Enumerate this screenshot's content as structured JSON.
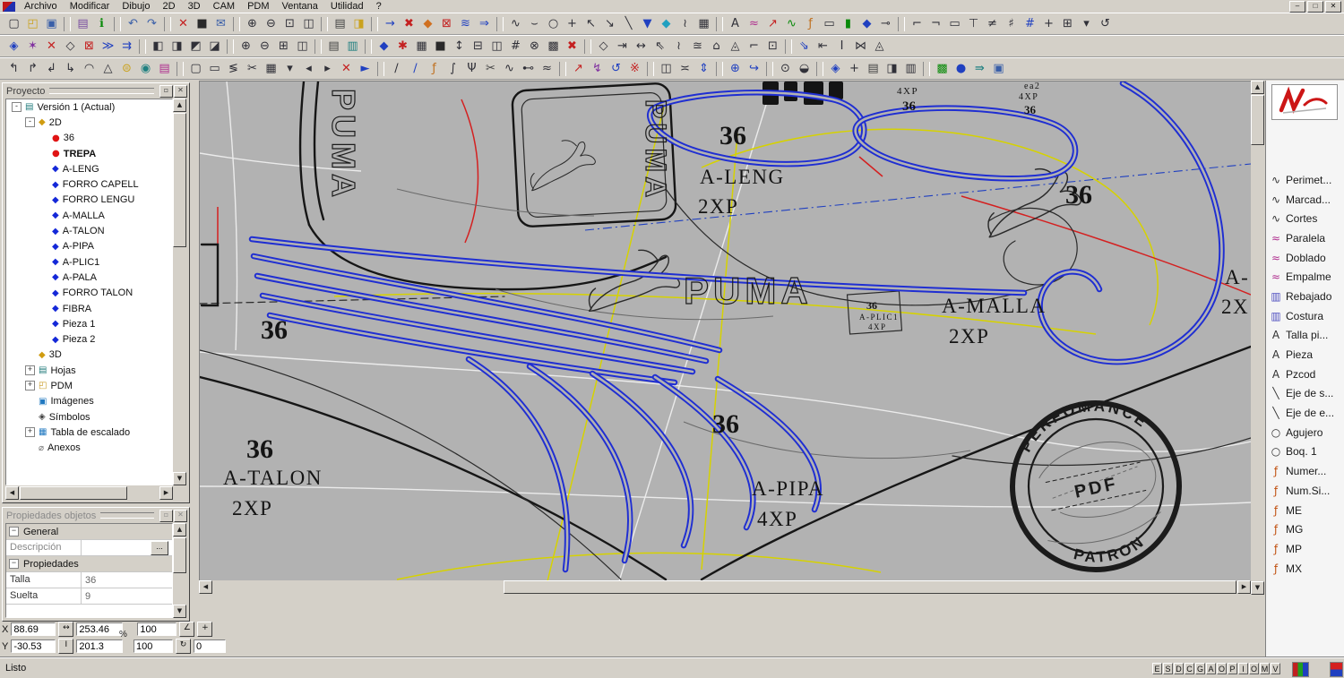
{
  "window": {
    "controls": [
      "–",
      "□",
      "✕"
    ]
  },
  "menu": {
    "items": [
      "Archivo",
      "Modificar",
      "Dibujo",
      "2D",
      "3D",
      "CAM",
      "PDM",
      "Ventana",
      "Utilidad",
      "?"
    ]
  },
  "toolbars": {
    "row1": [
      {
        "g": "▢"
      },
      {
        "g": "◰",
        "c": "#caa21e"
      },
      {
        "g": "▣",
        "c": "#3a5fa8"
      },
      {
        "cls": "sep"
      },
      {
        "g": "▤",
        "c": "#7a4fa0"
      },
      {
        "g": "ℹ",
        "c": "#0a8a0a"
      },
      {
        "cls": "sep"
      },
      {
        "g": "↶",
        "c": "#3a5fa8"
      },
      {
        "g": "↷",
        "c": "#3a5fa8"
      },
      {
        "cls": "sep"
      },
      {
        "g": "✕",
        "c": "#c42020"
      },
      {
        "g": "■",
        "c": "#2a2a2a"
      },
      {
        "g": "✉",
        "c": "#3a5fa8"
      },
      {
        "cls": "sep"
      },
      {
        "g": "⊕"
      },
      {
        "g": "⊖"
      },
      {
        "g": "⊡"
      },
      {
        "g": "◫"
      },
      {
        "cls": "sep"
      },
      {
        "g": "▤",
        "c": "#444444"
      },
      {
        "g": "◨",
        "c": "#caa21e"
      },
      {
        "cls": "sep"
      },
      {
        "g": "→",
        "c": "#2040c0"
      },
      {
        "g": "✖",
        "c": "#c42020"
      },
      {
        "g": "◆",
        "c": "#d07020"
      },
      {
        "g": "⊠",
        "c": "#c42020"
      },
      {
        "g": "≋",
        "c": "#2040c0"
      },
      {
        "g": "⇒",
        "c": "#2040c0"
      },
      {
        "cls": "sep"
      },
      {
        "g": "∿"
      },
      {
        "g": "⌣"
      },
      {
        "g": "○"
      },
      {
        "g": "+"
      },
      {
        "g": "↖"
      },
      {
        "g": "↘"
      },
      {
        "g": "╲"
      },
      {
        "g": "▼",
        "c": "#2040c0"
      },
      {
        "g": "◆",
        "c": "#20a0c0"
      },
      {
        "g": "≀"
      },
      {
        "g": "▦"
      },
      {
        "cls": "sep"
      },
      {
        "g": "A"
      },
      {
        "g": "≈",
        "c": "#b03090"
      },
      {
        "g": "↗",
        "c": "#c42020"
      },
      {
        "g": "∿",
        "c": "#0a8a0a"
      },
      {
        "g": "ƒ",
        "c": "#c07020"
      },
      {
        "g": "▭"
      },
      {
        "g": "▮",
        "c": "#0a8a0a"
      },
      {
        "g": "◆",
        "c": "#2040c0"
      },
      {
        "g": "⊸"
      },
      {
        "cls": "sep"
      },
      {
        "g": "⌐"
      },
      {
        "g": "¬"
      },
      {
        "g": "▭"
      },
      {
        "g": "⊤"
      },
      {
        "g": "≠"
      },
      {
        "g": "♯"
      },
      {
        "g": "#",
        "c": "#2040c0"
      },
      {
        "g": "+"
      },
      {
        "g": "⊞"
      },
      {
        "g": "▾"
      },
      {
        "g": "↺"
      }
    ],
    "row2": [
      {
        "g": "◈",
        "c": "#2040c0"
      },
      {
        "g": "✶",
        "c": "#8030a0"
      },
      {
        "g": "✕",
        "c": "#c42020"
      },
      {
        "g": "◇"
      },
      {
        "g": "⊠",
        "c": "#c42020"
      },
      {
        "g": "≫",
        "c": "#2040c0"
      },
      {
        "g": "⇉",
        "c": "#2040c0"
      },
      {
        "cls": "sep"
      },
      {
        "g": "◧"
      },
      {
        "g": "◨"
      },
      {
        "g": "◩"
      },
      {
        "g": "◪"
      },
      {
        "cls": "sep"
      },
      {
        "g": "⊕"
      },
      {
        "g": "⊖"
      },
      {
        "g": "⊞"
      },
      {
        "g": "◫"
      },
      {
        "cls": "sep"
      },
      {
        "g": "▤",
        "c": "#444444"
      },
      {
        "g": "▥",
        "c": "#208080"
      },
      {
        "cls": "sep"
      },
      {
        "g": "◆",
        "c": "#2040c0"
      },
      {
        "g": "✱",
        "c": "#c42020"
      },
      {
        "g": "▦"
      },
      {
        "g": "■",
        "c": "#2a2a2a"
      },
      {
        "g": "↕"
      },
      {
        "g": "⊟"
      },
      {
        "g": "◫"
      },
      {
        "g": "#"
      },
      {
        "g": "⊗"
      },
      {
        "g": "▩"
      },
      {
        "g": "✖",
        "c": "#c42020"
      },
      {
        "cls": "sep"
      },
      {
        "g": "◇"
      },
      {
        "g": "⇥"
      },
      {
        "g": "↔"
      },
      {
        "g": "⇖"
      },
      {
        "g": "≀"
      },
      {
        "g": "≊"
      },
      {
        "g": "⌂"
      },
      {
        "g": "◬"
      },
      {
        "g": "⌐"
      },
      {
        "g": "⊡"
      },
      {
        "cls": "sep"
      },
      {
        "g": "⇘",
        "c": "#2040c0"
      },
      {
        "g": "⇤"
      },
      {
        "g": "Ⅰ"
      },
      {
        "g": "⋈"
      },
      {
        "g": "◬"
      }
    ],
    "row3": [
      {
        "g": "↰"
      },
      {
        "g": "↱"
      },
      {
        "g": "↲"
      },
      {
        "g": "↳"
      },
      {
        "g": "◠"
      },
      {
        "g": "△"
      },
      {
        "g": "⊜",
        "c": "#caa21e"
      },
      {
        "g": "◉",
        "c": "#208080"
      },
      {
        "g": "▤",
        "c": "#b03090"
      },
      {
        "cls": "sep"
      },
      {
        "g": "▢"
      },
      {
        "g": "▭"
      },
      {
        "g": "≶"
      },
      {
        "g": "✂"
      },
      {
        "g": "▦"
      },
      {
        "g": "▾"
      },
      {
        "g": "◂"
      },
      {
        "g": "▸"
      },
      {
        "g": "✕",
        "c": "#c42020"
      },
      {
        "g": "►",
        "c": "#2040c0"
      },
      {
        "cls": "sep"
      },
      {
        "g": "∕"
      },
      {
        "g": "∕",
        "c": "#2040c0"
      },
      {
        "g": "ƒ",
        "c": "#c07020"
      },
      {
        "g": "∫"
      },
      {
        "g": "Ψ"
      },
      {
        "g": "✂",
        "c": "#444444"
      },
      {
        "g": "∿"
      },
      {
        "g": "⊷"
      },
      {
        "g": "≈"
      },
      {
        "cls": "sep"
      },
      {
        "g": "↗",
        "c": "#c42020"
      },
      {
        "g": "↯",
        "c": "#8030a0"
      },
      {
        "g": "↺",
        "c": "#2040c0"
      },
      {
        "g": "※",
        "c": "#c42020"
      },
      {
        "cls": "sep"
      },
      {
        "g": "◫"
      },
      {
        "g": "≍"
      },
      {
        "g": "⇕",
        "c": "#2040c0"
      },
      {
        "cls": "sep"
      },
      {
        "g": "⊕",
        "c": "#2040c0"
      },
      {
        "g": "↪",
        "c": "#2040c0"
      },
      {
        "cls": "sep"
      },
      {
        "g": "⊙"
      },
      {
        "g": "◒"
      },
      {
        "cls": "sep"
      },
      {
        "g": "◈",
        "c": "#2040c0"
      },
      {
        "g": "+"
      },
      {
        "g": "▤",
        "c": "#444444"
      },
      {
        "g": "◨"
      },
      {
        "g": "▥"
      },
      {
        "cls": "sep"
      },
      {
        "g": "▩",
        "c": "#0a8a0a"
      },
      {
        "g": "●",
        "c": "#2040c0"
      },
      {
        "g": "⇛",
        "c": "#208080"
      },
      {
        "g": "▣",
        "c": "#3a5fa8"
      }
    ]
  },
  "project_panel": {
    "title": "Proyecto",
    "min_btn": "▫",
    "close_btn": "✕",
    "tree": [
      {
        "label": "Versión 1 (Actual)",
        "lvl": 0,
        "icon": "▤",
        "ic": "#1f7a7a",
        "box": "-"
      },
      {
        "label": "2D",
        "lvl": 1,
        "icon": "◆",
        "ic": "#d09c10",
        "box": "-"
      },
      {
        "label": "36",
        "lvl": 2,
        "icon": "●",
        "ic": "#e01414"
      },
      {
        "label": "TREPA",
        "lvl": 2,
        "icon": "●",
        "ic": "#e01414",
        "cls": "bold"
      },
      {
        "label": "A-LENG",
        "lvl": 2,
        "icon": "◆",
        "ic": "#1428d8"
      },
      {
        "label": "FORRO CAPELL",
        "lvl": 2,
        "icon": "◆",
        "ic": "#1428d8"
      },
      {
        "label": "FORRO LENGU",
        "lvl": 2,
        "icon": "◆",
        "ic": "#1428d8"
      },
      {
        "label": "A-MALLA",
        "lvl": 2,
        "icon": "◆",
        "ic": "#1428d8"
      },
      {
        "label": "A-TALON",
        "lvl": 2,
        "icon": "◆",
        "ic": "#1428d8"
      },
      {
        "label": "A-PIPA",
        "lvl": 2,
        "icon": "◆",
        "ic": "#1428d8"
      },
      {
        "label": "A-PLIC1",
        "lvl": 2,
        "icon": "◆",
        "ic": "#1428d8"
      },
      {
        "label": "A-PALA",
        "lvl": 2,
        "icon": "◆",
        "ic": "#1428d8"
      },
      {
        "label": "FORRO TALON",
        "lvl": 2,
        "icon": "◆",
        "ic": "#1428d8"
      },
      {
        "label": "FIBRA",
        "lvl": 2,
        "icon": "◆",
        "ic": "#1428d8"
      },
      {
        "label": "Pieza 1",
        "lvl": 2,
        "icon": "◆",
        "ic": "#1428d8"
      },
      {
        "label": "Pieza 2",
        "lvl": 2,
        "icon": "◆",
        "ic": "#1428d8"
      },
      {
        "label": "3D",
        "lvl": 1,
        "icon": "◆",
        "ic": "#d09c10"
      },
      {
        "label": "Hojas",
        "lvl": 1,
        "icon": "▤",
        "ic": "#1f7a7a",
        "box": "+"
      },
      {
        "label": "PDM",
        "lvl": 1,
        "icon": "◰",
        "ic": "#c89a20",
        "box": "+"
      },
      {
        "label": "Imágenes",
        "lvl": 1,
        "icon": "▣",
        "ic": "#2078c0"
      },
      {
        "label": "Símbolos",
        "lvl": 1,
        "icon": "◈",
        "ic": "#404040"
      },
      {
        "label": "Tabla de escalado",
        "lvl": 1,
        "icon": "▦",
        "ic": "#2078c0",
        "box": "+"
      },
      {
        "label": "Anexos",
        "lvl": 1,
        "icon": "⌀",
        "ic": "#707070"
      }
    ]
  },
  "properties_panel": {
    "title": "Propiedades objetos",
    "min_btn": "▫",
    "close_btn": "✕",
    "collapse_glyph": "−",
    "general_header": "General",
    "desc_label": "Descripción",
    "desc_value": "",
    "more_btn": "...",
    "props_header": "Propiedades",
    "talla_label": "Talla",
    "talla_value": "36",
    "suelta_label": "Suelta",
    "suelta_value": "9"
  },
  "coords": {
    "x_label": "X",
    "x_value": "88.69",
    "x_dim_icon": "↔",
    "x_dim": "253.46",
    "percent": "%",
    "x_zoom": "100",
    "snap_icon": "∠",
    "grid_icon": "+",
    "y_label": "Y",
    "y_value": "-30.53",
    "y_dim_icon": "Ⅰ",
    "y_dim": "201.3",
    "y_zoom": "100",
    "rot_icon": "↻",
    "angle_value": "0"
  },
  "status_bar": {
    "ready": "Listo"
  },
  "layer_toggles": [
    "E",
    "S",
    "D",
    "C",
    "G",
    "A",
    "O",
    "P",
    "I",
    "O",
    "M",
    "V"
  ],
  "right_panel": {
    "tools": [
      {
        "icon": "∿",
        "label": "Perimet...",
        "ic": "#303030"
      },
      {
        "icon": "∿",
        "label": "Marcad...",
        "ic": "#303030"
      },
      {
        "icon": "∿",
        "label": "Cortes",
        "ic": "#303030"
      },
      {
        "icon": "≈",
        "label": "Paralela",
        "ic": "#b03090"
      },
      {
        "icon": "≈",
        "label": "Doblado",
        "ic": "#b03090"
      },
      {
        "icon": "≈",
        "label": "Empalme",
        "ic": "#b03090"
      },
      {
        "icon": "▥",
        "label": "Rebajado",
        "ic": "#5050c0"
      },
      {
        "icon": "▥",
        "label": "Costura",
        "ic": "#5050c0"
      },
      {
        "icon": "A",
        "label": "Talla pi...",
        "ic": "#303030"
      },
      {
        "icon": "A",
        "label": "Pieza",
        "ic": "#303030"
      },
      {
        "icon": "A",
        "label": "Pzcod",
        "ic": "#303030"
      },
      {
        "icon": "╲",
        "label": "Eje de s...",
        "ic": "#303030"
      },
      {
        "icon": "╲",
        "label": "Eje de e...",
        "ic": "#303030"
      },
      {
        "icon": "○",
        "label": "Agujero",
        "ic": "#303030"
      },
      {
        "icon": "○",
        "label": "Boq. 1",
        "ic": "#303030"
      },
      {
        "icon": "ƒ",
        "label": "Numer...",
        "ic": "#c05010"
      },
      {
        "icon": "ƒ",
        "label": "Num.Si...",
        "ic": "#c05010"
      },
      {
        "icon": "ƒ",
        "label": "ME",
        "ic": "#c05010"
      },
      {
        "icon": "ƒ",
        "label": "MG",
        "ic": "#c05010"
      },
      {
        "icon": "ƒ",
        "label": "MP",
        "ic": "#c05010"
      },
      {
        "icon": "ƒ",
        "label": "MX",
        "ic": "#c05010"
      }
    ]
  },
  "canvas": {
    "labels": {
      "size_top": "36",
      "aleng": "A-LENG",
      "aleng_qty": "2XP",
      "size_right": "36",
      "right_piece": "A-",
      "right_qty": "2X",
      "amalla": "A-MALLA",
      "amalla_qty": "2XP",
      "aplic_size": "36",
      "aplic": "A-PLIC1",
      "aplic_qty": "4XP",
      "size_mid_left": "36",
      "size_mid": "36",
      "size_low_left": "36",
      "atalon": "A-TALON",
      "atalon_qty": "2XP",
      "apipa": "A-PIPA",
      "apipa_qty": "4XP",
      "top_small_qty": "4XP",
      "top_small_size": "36",
      "tr_partial": "ea2",
      "tr_qty": "4XP",
      "tr_size": "36",
      "puma": "PUMA"
    },
    "stamp": {
      "top": "PERFOMANCE",
      "center": "PDF",
      "bottom": "PATRON"
    }
  }
}
